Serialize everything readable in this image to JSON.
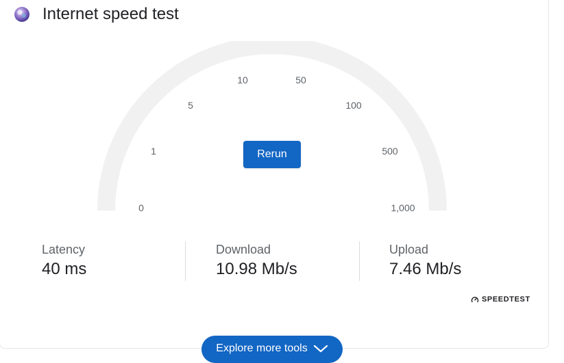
{
  "header": {
    "title": "Internet speed test",
    "logo_icon": "speedtest-orb-icon"
  },
  "gauge": {
    "scale_labels": [
      "0",
      "1",
      "5",
      "10",
      "50",
      "100",
      "500",
      "1,000"
    ],
    "track_color": "#f1f1f1"
  },
  "rerun": {
    "label": "Rerun"
  },
  "metrics": {
    "latency": {
      "label": "Latency",
      "value": "40 ms"
    },
    "download": {
      "label": "Download",
      "value": "10.98 Mb/s"
    },
    "upload": {
      "label": "Upload",
      "value": "7.46 Mb/s"
    }
  },
  "brand": {
    "label": "SPEEDTEST",
    "icon": "gauge-icon"
  },
  "explore": {
    "label": "Explore more tools",
    "icon": "chevron-down-icon"
  },
  "colors": {
    "accent": "#1266c4",
    "text": "#202124",
    "muted": "#5f6368"
  }
}
